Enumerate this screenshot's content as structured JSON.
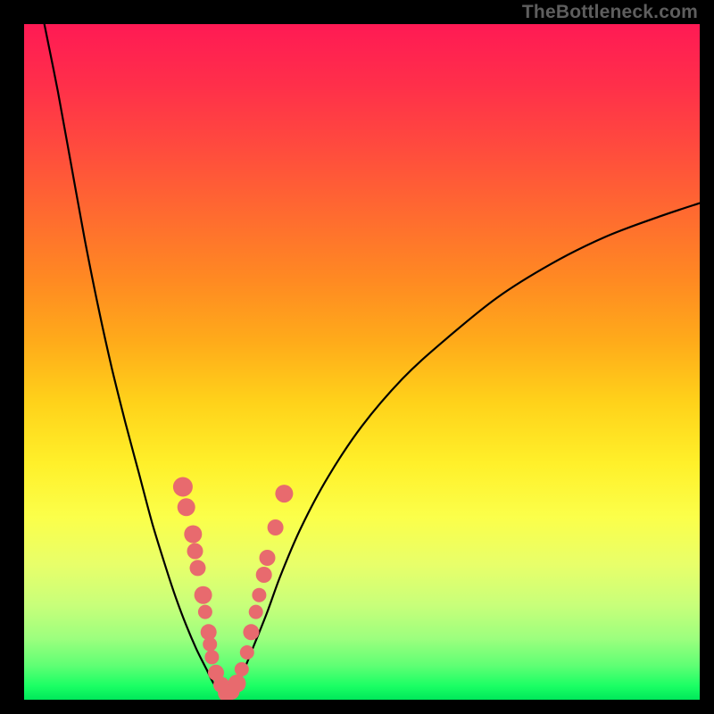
{
  "watermark": "TheBottleneck.com",
  "watermark_font_size_px": 21,
  "colors": {
    "frame": "#000000",
    "curve": "#000000",
    "marker": "#e86a6e"
  },
  "chart_data": {
    "type": "line",
    "title": "",
    "xlabel": "",
    "ylabel": "",
    "xlim": [
      0,
      100
    ],
    "ylim": [
      0,
      100
    ],
    "series": [
      {
        "name": "left-branch",
        "x": [
          3.0,
          5.0,
          7.0,
          9.0,
          11.0,
          13.0,
          15.0,
          17.0,
          19.0,
          21.0,
          22.5,
          24.0,
          25.5,
          27.0,
          28.0,
          29.0,
          30.0
        ],
        "values": [
          100.0,
          90.0,
          79.0,
          68.0,
          58.0,
          49.0,
          41.0,
          33.5,
          26.0,
          19.5,
          15.0,
          11.0,
          7.5,
          4.5,
          2.5,
          1.2,
          0.5
        ]
      },
      {
        "name": "right-branch",
        "x": [
          30.0,
          31.0,
          32.0,
          33.0,
          34.0,
          36.0,
          38.0,
          41.0,
          45.0,
          50.0,
          56.0,
          62.0,
          70.0,
          78.0,
          86.0,
          94.0,
          100.0
        ],
        "values": [
          0.5,
          1.5,
          3.2,
          5.5,
          8.0,
          13.0,
          18.5,
          25.5,
          33.0,
          40.5,
          47.5,
          53.0,
          59.5,
          64.5,
          68.5,
          71.5,
          73.5
        ]
      }
    ],
    "markers": [
      {
        "x": 23.5,
        "y": 31.5,
        "r": 11
      },
      {
        "x": 24.0,
        "y": 28.5,
        "r": 10
      },
      {
        "x": 25.0,
        "y": 24.5,
        "r": 10
      },
      {
        "x": 25.3,
        "y": 22.0,
        "r": 9
      },
      {
        "x": 25.7,
        "y": 19.5,
        "r": 9
      },
      {
        "x": 26.5,
        "y": 15.5,
        "r": 10
      },
      {
        "x": 26.8,
        "y": 13.0,
        "r": 8
      },
      {
        "x": 27.3,
        "y": 10.0,
        "r": 9
      },
      {
        "x": 27.5,
        "y": 8.2,
        "r": 8
      },
      {
        "x": 27.8,
        "y": 6.3,
        "r": 8
      },
      {
        "x": 28.4,
        "y": 4.0,
        "r": 9
      },
      {
        "x": 29.2,
        "y": 2.2,
        "r": 9
      },
      {
        "x": 30.0,
        "y": 1.0,
        "r": 10
      },
      {
        "x": 30.7,
        "y": 1.2,
        "r": 9
      },
      {
        "x": 31.5,
        "y": 2.4,
        "r": 10
      },
      {
        "x": 32.2,
        "y": 4.5,
        "r": 8
      },
      {
        "x": 33.0,
        "y": 7.0,
        "r": 8
      },
      {
        "x": 33.6,
        "y": 10.0,
        "r": 9
      },
      {
        "x": 34.3,
        "y": 13.0,
        "r": 8
      },
      {
        "x": 34.8,
        "y": 15.5,
        "r": 8
      },
      {
        "x": 35.5,
        "y": 18.5,
        "r": 9
      },
      {
        "x": 36.0,
        "y": 21.0,
        "r": 9
      },
      {
        "x": 37.2,
        "y": 25.5,
        "r": 9
      },
      {
        "x": 38.5,
        "y": 30.5,
        "r": 10
      }
    ]
  }
}
